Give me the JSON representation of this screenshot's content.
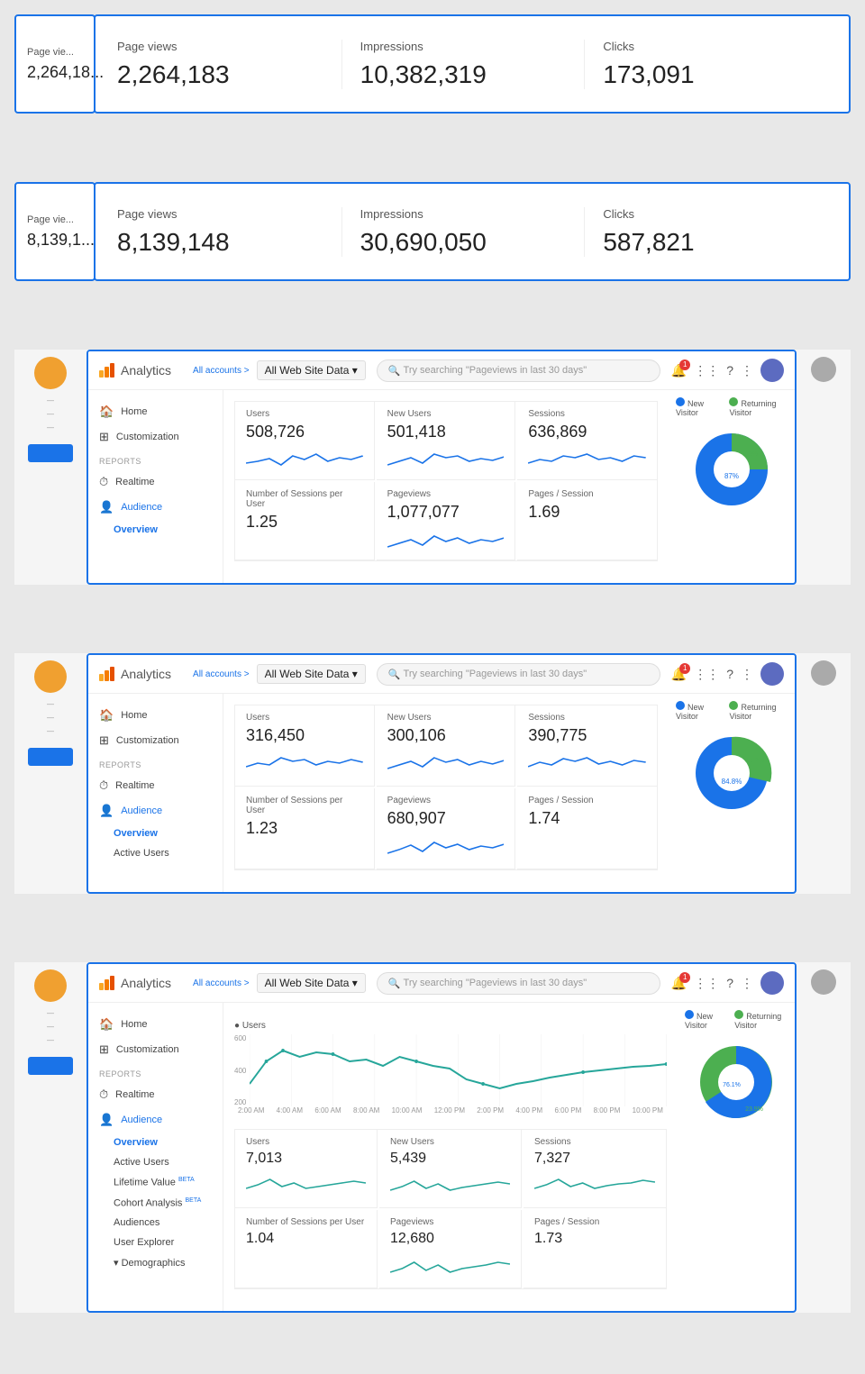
{
  "section1": {
    "peek_label": "Page vie...",
    "peek_value": "2,264,18...",
    "stats": [
      {
        "label": "Page views",
        "value": "2,264,183"
      },
      {
        "label": "Impressions",
        "value": "10,382,319"
      },
      {
        "label": "Clicks",
        "value": "173,091"
      }
    ]
  },
  "section2": {
    "peek_label": "Page vie...",
    "peek_value": "8,139,1...",
    "stats": [
      {
        "label": "Page views",
        "value": "8,139,148"
      },
      {
        "label": "Impressions",
        "value": "30,690,050"
      },
      {
        "label": "Clicks",
        "value": "587,821"
      }
    ]
  },
  "analytics1": {
    "breadcrumb": "All accounts >",
    "title": "Analytics",
    "property": "All Web Site Data ▾",
    "search_placeholder": "Try searching \"Pageviews in last 30 days\"",
    "metrics": [
      {
        "label": "Users",
        "value": "508,726"
      },
      {
        "label": "New Users",
        "value": "501,418"
      },
      {
        "label": "Sessions",
        "value": "636,869"
      },
      {
        "label": "Number of Sessions per User",
        "value": "1.25"
      },
      {
        "label": "Pageviews",
        "value": "1,077,077"
      },
      {
        "label": "Pages / Session",
        "value": "1.69"
      }
    ],
    "sidebar": {
      "home": "Home",
      "customization": "Customization",
      "reports": "REPORTS",
      "realtime": "Realtime",
      "audience": "Audience",
      "overview": "Overview"
    },
    "pie": {
      "new_visitor_pct": 13,
      "returning_visitor_pct": 87,
      "new_label": "New Visitor",
      "returning_label": "Returning Visitor",
      "new_color": "#4caf50",
      "returning_color": "#1a73e8"
    }
  },
  "analytics2": {
    "breadcrumb": "All accounts >",
    "title": "Analytics",
    "property": "All Web Site Data ▾",
    "search_placeholder": "Try searching \"Pageviews in last 30 days\"",
    "metrics": [
      {
        "label": "Users",
        "value": "316,450"
      },
      {
        "label": "New Users",
        "value": "300,106"
      },
      {
        "label": "Sessions",
        "value": "390,775"
      },
      {
        "label": "Number of Sessions per User",
        "value": "1.23"
      },
      {
        "label": "Pageviews",
        "value": "680,907"
      },
      {
        "label": "Pages / Session",
        "value": "1.74"
      }
    ],
    "sidebar": {
      "home": "Home",
      "customization": "Customization",
      "reports": "REPORTS",
      "realtime": "Realtime",
      "audience": "Audience",
      "overview": "Overview",
      "active_users": "Active Users"
    },
    "pie": {
      "new_visitor_pct": 15,
      "returning_visitor_pct": 85,
      "new_label": "New Visitor",
      "returning_label": "Returning Visitor",
      "new_color": "#4caf50",
      "returning_color": "#1a73e8"
    }
  },
  "analytics3": {
    "breadcrumb": "All accounts >",
    "title": "Analytics",
    "property": "All Web Site Data ▾",
    "search_placeholder": "Try searching \"Pageviews in last 30 days\"",
    "chart_label": "● Users",
    "chart_y_labels": [
      "600",
      "400",
      "200"
    ],
    "chart_x_labels": [
      "2:00 AM",
      "4:00 AM",
      "6:00 AM",
      "8:00 AM",
      "10:00 AM",
      "12:00 PM",
      "2:00 PM",
      "4:00 PM",
      "6:00 PM",
      "8:00 PM",
      "10:00 PM"
    ],
    "metrics": [
      {
        "label": "Users",
        "value": "7,013"
      },
      {
        "label": "New Users",
        "value": "5,439"
      },
      {
        "label": "Sessions",
        "value": "7,327"
      },
      {
        "label": "Number of Sessions per User",
        "value": "1.04"
      },
      {
        "label": "Pageviews",
        "value": "12,680"
      },
      {
        "label": "Pages / Session",
        "value": "1.73"
      }
    ],
    "sidebar": {
      "home": "Home",
      "customization": "Customization",
      "reports": "REPORTS",
      "realtime": "Realtime",
      "audience": "Audience",
      "overview": "Overview",
      "active_users": "Active Users",
      "lifetime": "Lifetime Value",
      "cohort": "Cohort Analysis",
      "audiences": "Audiences",
      "user_explorer": "User Explorer",
      "demographics": "▾ Demographics"
    },
    "pie": {
      "new_visitor_pct": 24,
      "returning_visitor_pct": 76,
      "new_label": "New Visitor",
      "returning_label": "Returning Visitor",
      "new_color": "#4caf50",
      "returning_color": "#1a73e8"
    }
  },
  "colors": {
    "blue_border": "#1a73e8",
    "orange_logo": "#f57c00"
  }
}
